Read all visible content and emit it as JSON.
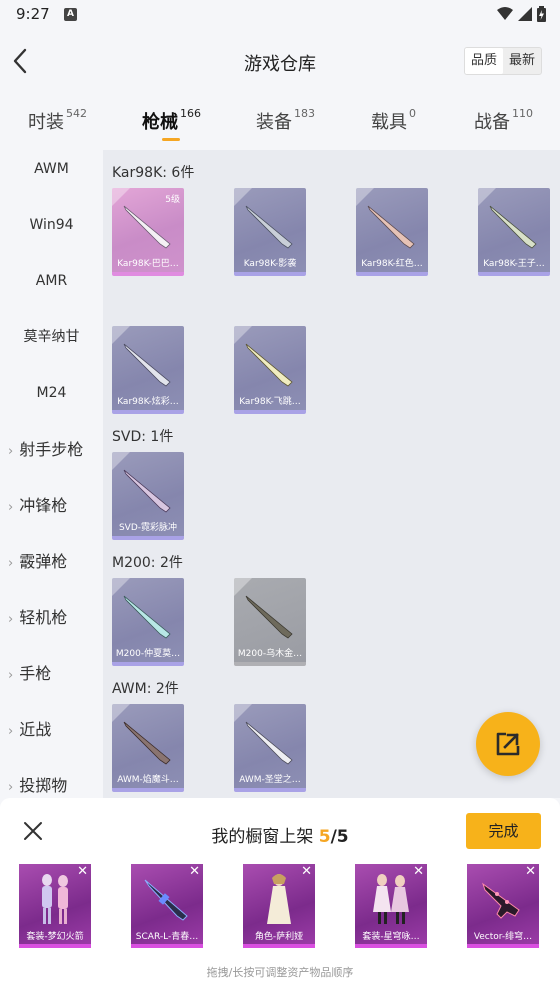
{
  "status": {
    "time": "9:27",
    "notif_icon": "A"
  },
  "header": {
    "title": "游戏仓库",
    "sort": [
      "品质",
      "最新"
    ]
  },
  "tabs": [
    {
      "label": "时装",
      "count": "542"
    },
    {
      "label": "枪械",
      "count": "166"
    },
    {
      "label": "装备",
      "count": "183"
    },
    {
      "label": "载具",
      "count": "0"
    },
    {
      "label": "战备",
      "count": "110"
    }
  ],
  "sidebar": [
    {
      "label": "AWM"
    },
    {
      "label": "Win94"
    },
    {
      "label": "AMR"
    },
    {
      "label": "莫辛纳甘"
    },
    {
      "label": "M24"
    },
    {
      "label": "射手步枪",
      "chevron": "›"
    },
    {
      "label": "冲锋枪",
      "chevron": "›"
    },
    {
      "label": "霰弹枪",
      "chevron": "›"
    },
    {
      "label": "轻机枪",
      "chevron": "›"
    },
    {
      "label": "手枪",
      "chevron": "›"
    },
    {
      "label": "近战",
      "chevron": "›"
    },
    {
      "label": "投掷物",
      "chevron": "›"
    }
  ],
  "sections": [
    {
      "title": "Kar98K: 6件",
      "items": [
        {
          "name": "Kar98K-巴巴…",
          "level": "5级",
          "rarity": "pink"
        },
        {
          "name": "Kar98K-影袭",
          "rarity": "blue"
        },
        {
          "name": "Kar98K-红色…",
          "rarity": "blue"
        },
        {
          "name": "Kar98K-王子…",
          "rarity": "blue"
        },
        {
          "name": "Kar98K-炫彩…",
          "rarity": "blue"
        },
        {
          "name": "Kar98K-飞跳…",
          "rarity": "blue"
        }
      ]
    },
    {
      "title": "SVD: 1件",
      "items": [
        {
          "name": "SVD-霓彩脉冲",
          "rarity": "blue"
        }
      ]
    },
    {
      "title": "M200: 2件",
      "items": [
        {
          "name": "M200-仲夏莫…",
          "rarity": "blue"
        },
        {
          "name": "M200-乌木金…",
          "rarity": "grey"
        }
      ]
    },
    {
      "title": "AWM: 2件",
      "items": [
        {
          "name": "AWM-焰魔斗…",
          "rarity": "blue"
        },
        {
          "name": "AWM-圣堂之…",
          "rarity": "blue"
        }
      ]
    }
  ],
  "panel": {
    "title_prefix": "我的橱窗上架 ",
    "count": "5",
    "total": "/5",
    "done_label": "完成",
    "hint": "拖拽/长按可调整资产物品顺序",
    "items": [
      {
        "name": "套装-梦幻火箭",
        "remove": "✕"
      },
      {
        "name": "SCAR-L-青春…",
        "remove": "✕"
      },
      {
        "name": "角色-萨利娅",
        "remove": "✕"
      },
      {
        "name": "套装-星穹咏…",
        "remove": "✕"
      },
      {
        "name": "Vector-绯穹…",
        "remove": "✕"
      }
    ]
  },
  "icons": {
    "back": "back-arrow-icon",
    "share": "share-external-icon",
    "close": "close-icon"
  },
  "colors": {
    "accent": "#f7b21a",
    "tab_underline": "#f5a623"
  }
}
